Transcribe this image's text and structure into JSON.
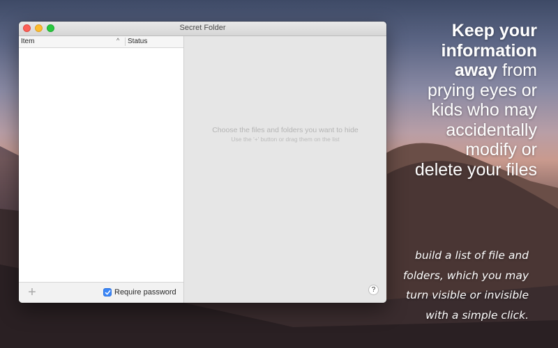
{
  "window": {
    "title": "Secret Folder"
  },
  "table": {
    "columns": [
      "Item",
      "Status"
    ],
    "sort_indicator": "^"
  },
  "footer": {
    "add_label": "+",
    "require_password_label": "Require password",
    "require_password_checked": true
  },
  "placeholder": {
    "main": "Choose the files and folders you want to hide",
    "sub": "Use the '+' button or drag them on the list"
  },
  "help": {
    "label": "?"
  },
  "promo": {
    "headline_lines": [
      {
        "bold": "Keep your",
        "rest": ""
      },
      {
        "bold": "information",
        "rest": ""
      },
      {
        "bold": "away",
        "rest": " from"
      },
      {
        "bold": "",
        "rest": "prying eyes or"
      },
      {
        "bold": "",
        "rest": "kids who may"
      },
      {
        "bold": "",
        "rest": "accidentally"
      },
      {
        "bold": "",
        "rest": "modify or"
      },
      {
        "bold": "",
        "rest": "delete your files"
      }
    ],
    "tagline_lines": [
      "build a list of file and",
      "folders, which you may",
      "turn visible or invisible",
      "with a simple click."
    ]
  },
  "colors": {
    "checkbox_accent": "#3b86f7",
    "close": "#fd5f57",
    "minimize": "#febc2e",
    "maximize": "#28c840"
  },
  "icons": {
    "add": "plus-icon",
    "help": "question-icon",
    "sort": "chevron-up-icon",
    "check": "checkmark-icon"
  }
}
